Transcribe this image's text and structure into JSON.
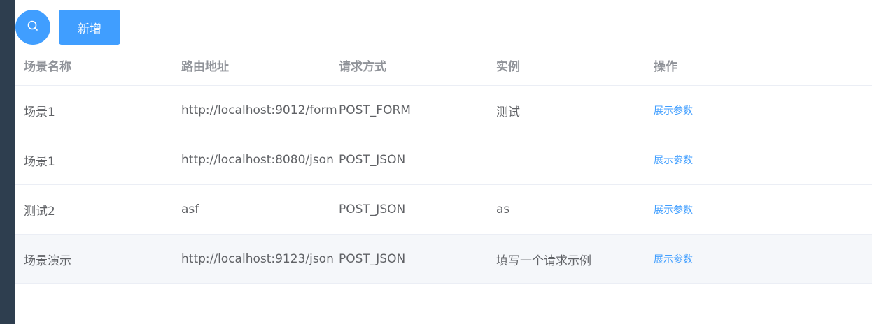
{
  "toolbar": {
    "search_icon": "search-icon",
    "add_label": "新增"
  },
  "table": {
    "columns": [
      "场景名称",
      "路由地址",
      "请求方式",
      "实例",
      "操作"
    ],
    "rows": [
      {
        "name": "场景1",
        "route": "http://localhost:9012/form",
        "method": "POST_FORM",
        "example": "测试",
        "action": "展示参数"
      },
      {
        "name": "场景1",
        "route": "http://localhost:8080/json",
        "method": "POST_JSON",
        "example": "",
        "action": "展示参数"
      },
      {
        "name": "测试2",
        "route": "asf",
        "method": "POST_JSON",
        "example": "as",
        "action": "展示参数"
      },
      {
        "name": "场景演示",
        "route": "http://localhost:9123/json",
        "method": "POST_JSON",
        "example": "填写一个请求示例",
        "action": "展示参数"
      }
    ]
  },
  "colors": {
    "primary": "#409eff",
    "sidebar": "#2e3e4f",
    "hover_row": "#f5f7fa"
  }
}
